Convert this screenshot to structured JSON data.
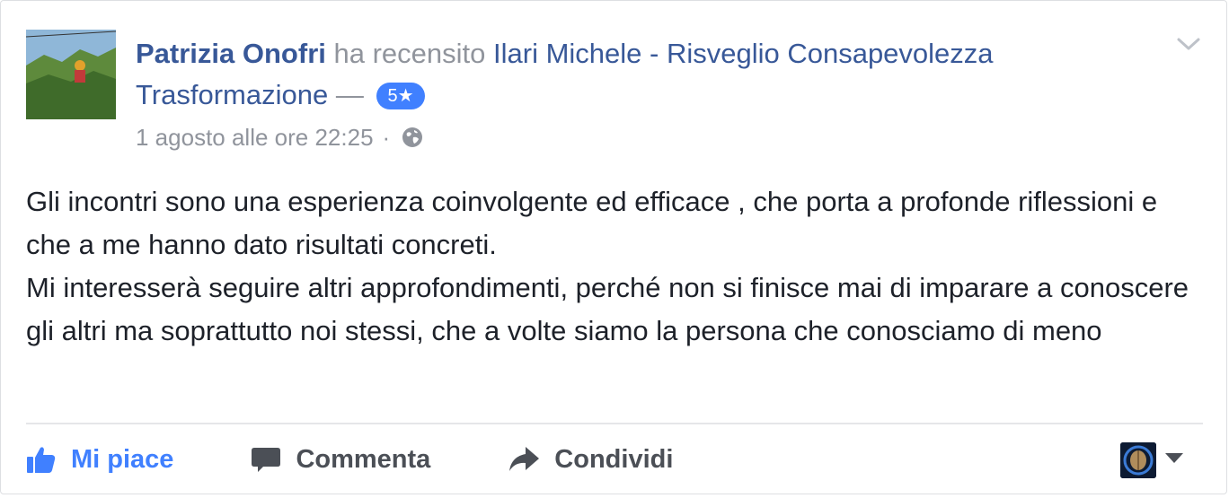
{
  "review": {
    "author": "Patrizia Onofri",
    "verb": "ha recensito",
    "page_name": "Ilari Michele - Risveglio Consapevolezza Trasformazione",
    "dash": "—",
    "rating_label": "5★",
    "timestamp": "1 agosto alle ore 22:25",
    "separator": "·",
    "privacy_icon": "globe-icon",
    "options_icon": "chevron-down-icon",
    "body": [
      "Gli incontri sono una esperienza coinvolgente ed efficace , che porta a profonde riflessioni e che a me hanno dato risultati concreti.",
      "Mi interesserà seguire altri approfondimenti, perché non si finisce mai di imparare a conoscere gli altri ma soprattutto noi stessi, che a volte siamo la persona che conosciamo di meno"
    ]
  },
  "actions": {
    "like_label": "Mi piace",
    "comment_label": "Comment­a",
    "share_label": "Condividi",
    "like_icon": "thumbs-up-icon",
    "comment_icon": "speech-bubble-icon",
    "share_icon": "share-arrow-icon"
  },
  "colors": {
    "link": "#385898",
    "muted": "#90949c",
    "like_active": "#4080ff",
    "badge": "#4080ff",
    "action_text": "#4b4f56"
  }
}
